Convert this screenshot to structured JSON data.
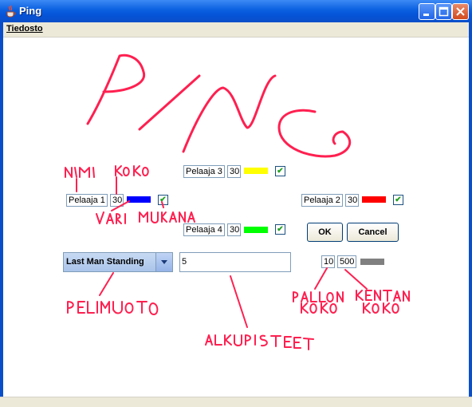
{
  "window": {
    "title": "Ping"
  },
  "menu": {
    "file_label": "Tiedosto"
  },
  "players": [
    {
      "name": "Pelaaja 1",
      "size": "30",
      "color": "#0000ff",
      "enabled": true
    },
    {
      "name": "Pelaaja 2",
      "size": "30",
      "color": "#ff0000",
      "enabled": true
    },
    {
      "name": "Pelaaja 3",
      "size": "30",
      "color": "#ffff00",
      "enabled": true
    },
    {
      "name": "Pelaaja 4",
      "size": "30",
      "color": "#00ff00",
      "enabled": true
    }
  ],
  "buttons": {
    "ok_label": "OK",
    "cancel_label": "Cancel"
  },
  "game": {
    "mode": "Last Man Standing",
    "start_points": "5",
    "ball_size": "10",
    "field_size": "500",
    "field_color": "#808080"
  },
  "colors": {
    "annotation": "#ff2050",
    "titlebar": "#0a5fe0"
  }
}
